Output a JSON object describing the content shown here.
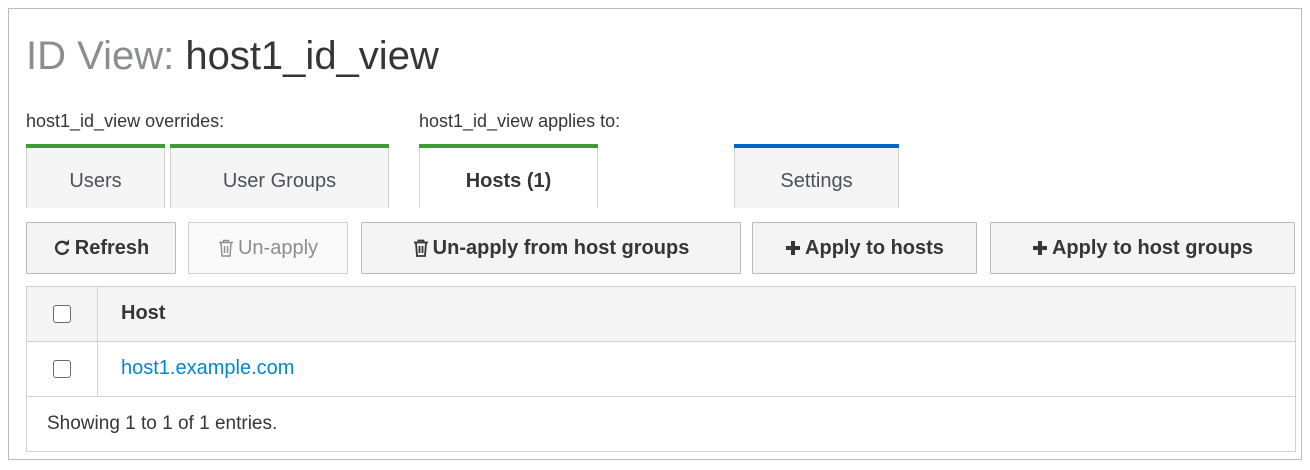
{
  "page": {
    "title_prefix": "ID View: ",
    "title_name": "host1_id_view"
  },
  "tab_groups": {
    "overrides_label": "host1_id_view overrides:",
    "applies_label": "host1_id_view applies to:"
  },
  "tabs": [
    {
      "label": "Users",
      "active": false,
      "accent": "#3f9c35"
    },
    {
      "label": "User Groups",
      "active": false,
      "accent": "#3f9c35"
    },
    {
      "label": "Hosts (1)",
      "active": true,
      "accent": "#3f9c35"
    },
    {
      "label": "Settings",
      "active": false,
      "accent": "#0066cc"
    }
  ],
  "toolbar": {
    "refresh_label": "Refresh",
    "unapply_label": "Un-apply",
    "unapply_groups_label": "Un-apply from host groups",
    "apply_hosts_label": "Apply to hosts",
    "apply_groups_label": "Apply to host groups"
  },
  "table": {
    "columns": [
      "Host"
    ],
    "rows": [
      {
        "host": "host1.example.com"
      }
    ],
    "footer": "Showing 1 to 1 of 1 entries."
  },
  "icons": {
    "refresh": "refresh-icon",
    "trash": "trash-icon",
    "plus": "plus-icon"
  },
  "colors": {
    "tab_accent_green": "#3f9c35",
    "tab_accent_blue": "#0066cc",
    "link": "#0088ce"
  }
}
